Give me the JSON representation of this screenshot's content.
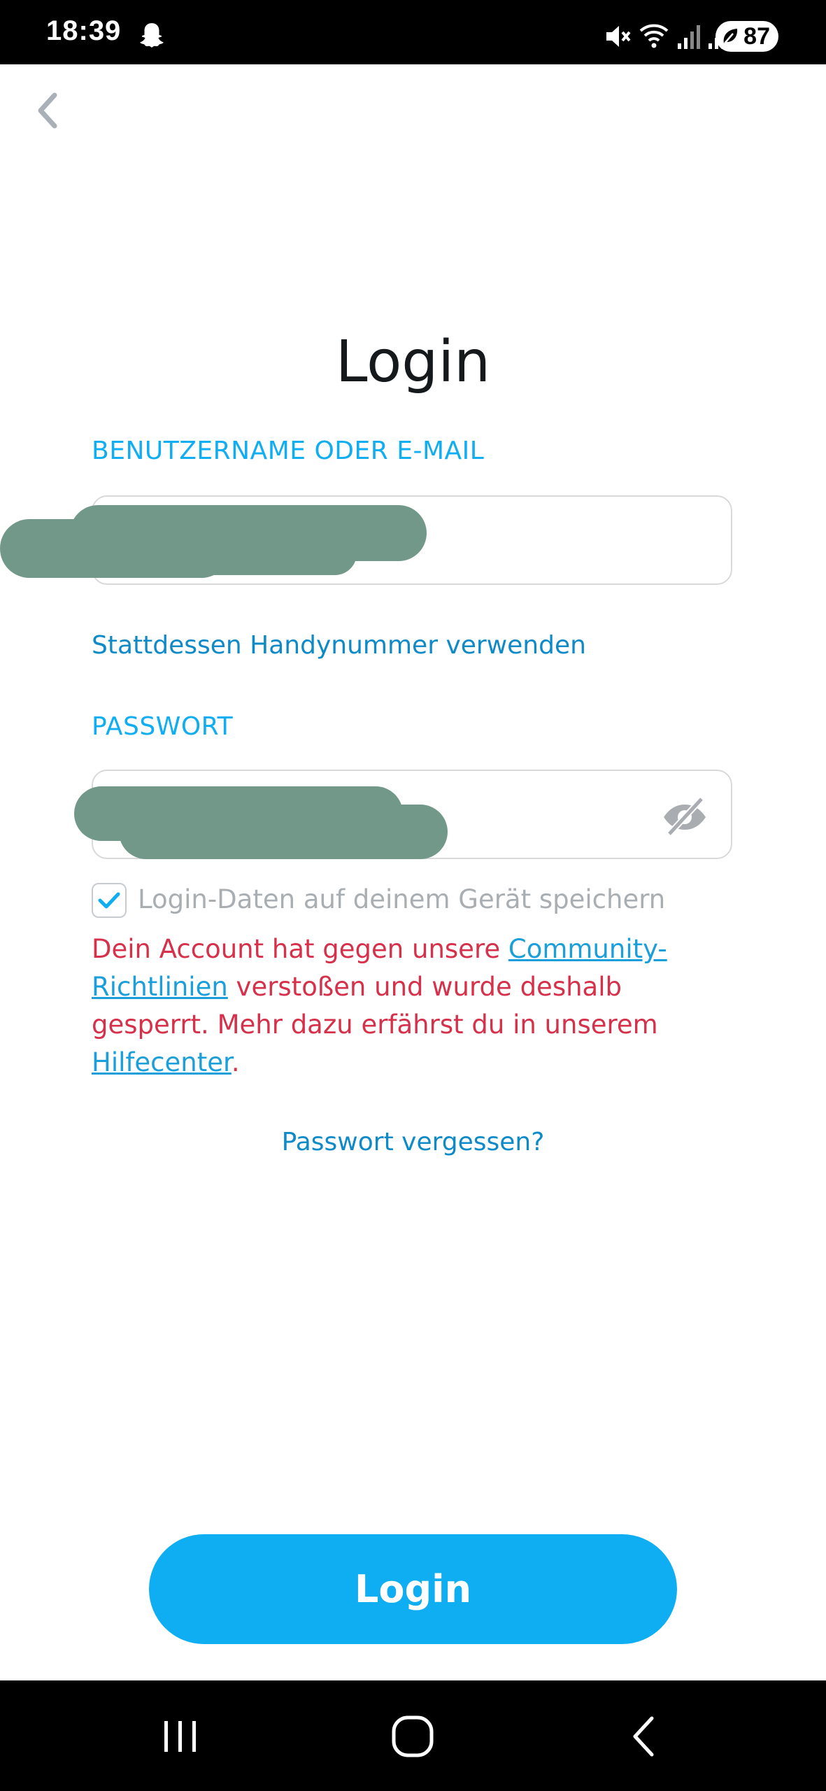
{
  "status_bar": {
    "time": "18:39",
    "battery": "87",
    "icons": [
      "snapchat-ghost-icon",
      "mute-icon",
      "wifi-icon",
      "signal-icon",
      "signal-icon",
      "battery-icon"
    ]
  },
  "header": {
    "back_icon": "chevron-left-icon"
  },
  "title": "Login",
  "username": {
    "label": "BENUTZERNAME ODER E-MAIL",
    "value": ""
  },
  "use_phone_link": "Stattdessen Handynummer verwenden",
  "password": {
    "label": "PASSWORT",
    "value": "",
    "visibility_icon": "eye-off-icon"
  },
  "remember": {
    "checked": true,
    "label": "Login-Daten auf deinem Gerät speichern"
  },
  "error": {
    "part1": "Dein Account hat gegen unsere ",
    "guidelines_link": "Community-Richtlinien",
    "part2": " verstoßen und wurde deshalb gesperrt. Mehr dazu erfährst du in unserem ",
    "help_link": "Hilfecenter",
    "part3": "."
  },
  "forgot_password": "Passwort vergessen?",
  "login_button": "Login",
  "colors": {
    "accent": "#0fadf1",
    "link": "#0e8ac8",
    "error": "#d6304a",
    "redaction": "#719889"
  },
  "nav_bar": {
    "icons": [
      "recent-apps-icon",
      "home-icon",
      "back-icon"
    ]
  }
}
